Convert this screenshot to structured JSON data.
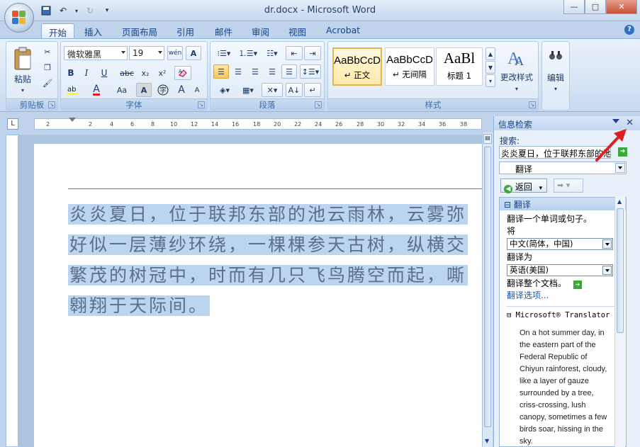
{
  "window": {
    "title": "dr.docx - Microsoft Word",
    "controls": [
      "—",
      "□",
      "✕"
    ]
  },
  "tabs": [
    "开始",
    "插入",
    "页面布局",
    "引用",
    "邮件",
    "审阅",
    "视图",
    "Acrobat"
  ],
  "ribbon": {
    "clipboard": {
      "label": "剪贴板",
      "paste": "粘贴"
    },
    "font": {
      "label": "字体",
      "font_name": "微软雅黑",
      "font_size": "19",
      "bold": "B",
      "italic": "I",
      "underline": "U",
      "strike": "abc",
      "subscript": "x₂",
      "superscript": "x²",
      "font_color": "A",
      "change_case": "Aa",
      "char_shading": "A",
      "enclose": "字",
      "grow": "A",
      "shrink": "A",
      "phonetic": "wén",
      "border": "A"
    },
    "paragraph": {
      "label": "段落"
    },
    "styles": {
      "label": "样式",
      "items": [
        {
          "sample": "AaBbCcD",
          "name": "↵ 正文"
        },
        {
          "sample": "AaBbCcD",
          "name": "↵ 无间隔"
        },
        {
          "sample": "AaBl",
          "name": "标题 1"
        }
      ],
      "change_styles": "更改样式"
    },
    "editing": {
      "label": "编辑"
    }
  },
  "ruler": {
    "ticks": [
      "2",
      "2",
      "4",
      "6",
      "8",
      "10",
      "12",
      "14",
      "16",
      "18",
      "20",
      "22",
      "24",
      "26",
      "28",
      "30",
      "32",
      "34",
      "36",
      "38"
    ]
  },
  "document": {
    "lines": [
      "炎炎夏日，位于联邦东部的池云雨林，云雾弥",
      "好似一层薄纱环绕，一棵棵参天古树，纵横交",
      "繁茂的树冠中，时而有几只飞鸟腾空而起，嘶",
      "翱翔于天际间。"
    ]
  },
  "research_pane": {
    "title": "信息检索",
    "search_label": "搜索:",
    "search_value": "炎炎夏日，位于联邦东部的池",
    "service": "翻译",
    "back": "返回",
    "section": "翻译",
    "translate_word": "翻译一个单词或句子。",
    "from_label": "将",
    "from_lang": "中文(简体，中国)",
    "to_label": "翻译为",
    "to_lang": "英语(美国)",
    "translate_doc": "翻译整个文档。",
    "options": "翻译选项...",
    "translator_name": "Microsoft® Translator",
    "translation": "On a hot summer day, in the eastern part of the Federal Republic of Chiyun rainforest, cloudy, like a layer of gauze surrounded by a tree, criss-crossing, lush canopy, sometimes a few birds soar, hissing in the sky."
  },
  "colors": {
    "accent": "#15428b",
    "selection": "#bcd5ee",
    "annotation_arrow": "#e02020"
  }
}
